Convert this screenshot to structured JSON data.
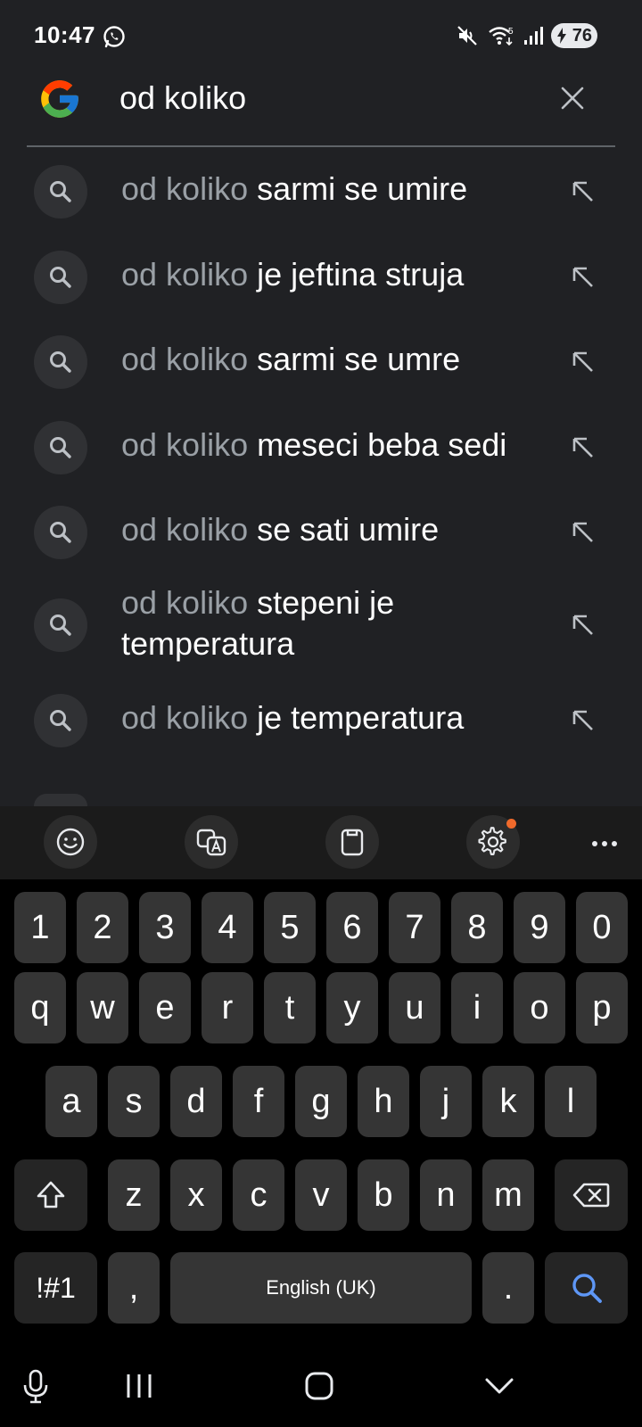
{
  "status_bar": {
    "time": "10:47",
    "battery": "76",
    "icons": [
      "whatsapp-icon",
      "mute-icon",
      "wifi-icon",
      "signal-icon",
      "battery-icon"
    ]
  },
  "search": {
    "query": "od koliko"
  },
  "suggestions": [
    {
      "prefix": "od koliko",
      "suffix": " sarmi se umire"
    },
    {
      "prefix": "od koliko",
      "suffix": " je jeftina struja"
    },
    {
      "prefix": "od koliko",
      "suffix": " sarmi se umre"
    },
    {
      "prefix": "od koliko",
      "suffix": " meseci beba sedi"
    },
    {
      "prefix": "od koliko",
      "suffix": " se sati umire"
    },
    {
      "prefix": "od koliko",
      "suffix": " stepeni je temperatura"
    },
    {
      "prefix": "od koliko",
      "suffix": " je temperatura"
    }
  ],
  "keyboard": {
    "row_numbers": [
      "1",
      "2",
      "3",
      "4",
      "5",
      "6",
      "7",
      "8",
      "9",
      "0"
    ],
    "row_top": [
      "q",
      "w",
      "e",
      "r",
      "t",
      "y",
      "u",
      "i",
      "o",
      "p"
    ],
    "row_middle": [
      "a",
      "s",
      "d",
      "f",
      "g",
      "h",
      "j",
      "k",
      "l"
    ],
    "row_bottom": [
      "z",
      "x",
      "c",
      "v",
      "b",
      "n",
      "m"
    ],
    "symbols_label": "!#1",
    "comma_label": ",",
    "space_label": "English (UK)",
    "period_label": ".",
    "accent_color": "#5e97f6",
    "notification_dot_color": "#f06a2b"
  },
  "colors": {
    "background": "#202124",
    "text_primary": "#ffffff",
    "text_secondary": "#9aa0a6"
  }
}
